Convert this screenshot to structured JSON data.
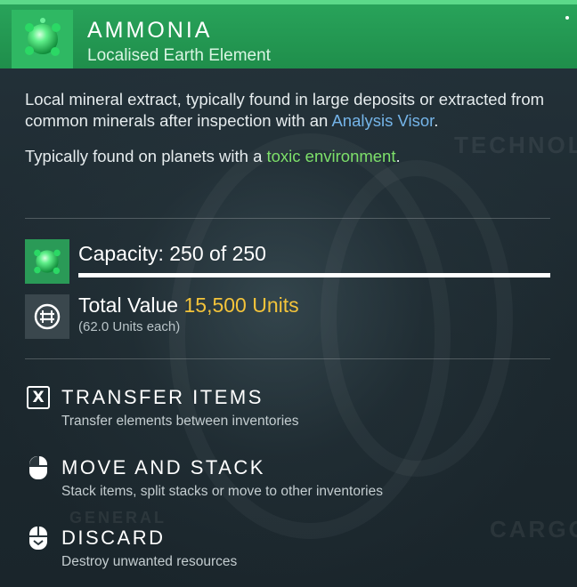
{
  "header": {
    "title": "AMMONIA",
    "subtitle": "Localised Earth Element",
    "icon": "ammonia-orb-icon",
    "accent_color": "#1f8e4b"
  },
  "background_watermarks": [
    "TECHNOLO",
    "GENERAL",
    "CARGO"
  ],
  "description": {
    "line1_prefix": "Local mineral extract, typically found in large deposits or extracted from common minerals after inspection with an ",
    "line1_link": "Analysis Visor",
    "line1_suffix": ".",
    "line2_prefix": "Typically found on planets with a ",
    "line2_highlight": "toxic environment",
    "line2_suffix": "."
  },
  "capacity": {
    "label": "Capacity: 250 of 250",
    "current": 250,
    "max": 250,
    "fill_fraction": 1.0
  },
  "value": {
    "label": "Total Value",
    "amount": "15,500 Units",
    "each": "(62.0 Units each)",
    "icon": "units-currency-icon",
    "amount_color": "#f3c33a"
  },
  "actions": [
    {
      "key": "X",
      "title": "TRANSFER ITEMS",
      "desc": "Transfer elements between inventories",
      "icon": "x-key-icon"
    },
    {
      "title": "MOVE AND STACK",
      "desc": "Stack items, split stacks or move to other inventories",
      "icon": "mouse-left-click-icon"
    },
    {
      "title": "DISCARD",
      "desc": "Destroy unwanted resources",
      "icon": "mouse-hold-icon"
    }
  ]
}
